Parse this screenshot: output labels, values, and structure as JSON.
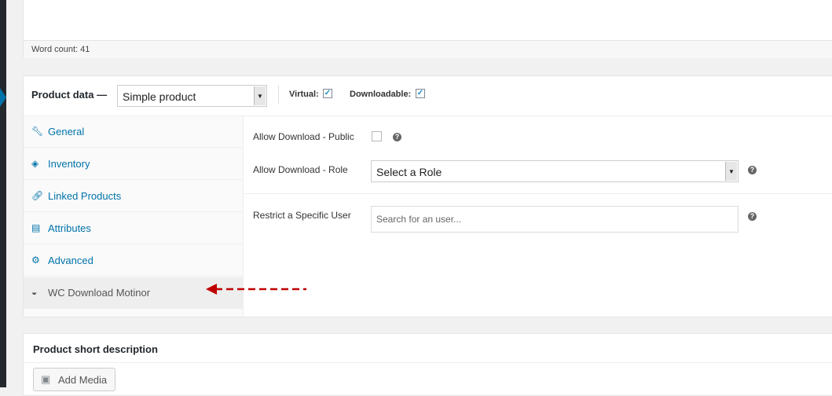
{
  "editor": {
    "word_count": "Word count: 41"
  },
  "product_data": {
    "title": "Product data —",
    "type_select": "Simple product",
    "virtual_label": "Virtual:",
    "virtual_checked": true,
    "downloadable_label": "Downloadable:",
    "downloadable_checked": true
  },
  "tabs": [
    {
      "label": "General",
      "icon": "wrench-icon"
    },
    {
      "label": "Inventory",
      "icon": "tag-icon"
    },
    {
      "label": "Linked Products",
      "icon": "link-icon"
    },
    {
      "label": "Attributes",
      "icon": "list-icon"
    },
    {
      "label": "Advanced",
      "icon": "gear-icon"
    },
    {
      "label": "WC Download Motinor",
      "icon": "dashboard-icon",
      "active": true
    }
  ],
  "panel": {
    "allow_public_label": "Allow Download - Public",
    "allow_public_checked": false,
    "allow_role_label": "Allow Download - Role",
    "role_select": "Select a Role",
    "restrict_user_label": "Restrict a Specific User",
    "user_search_placeholder": "Search for an user...",
    "help_glyph": "?"
  },
  "annotation": {
    "color": "#c00000"
  },
  "short_description": {
    "title": "Product short description",
    "add_media": "Add Media"
  },
  "colors": {
    "link": "#0073aa",
    "admin_bar": "#23282d"
  }
}
